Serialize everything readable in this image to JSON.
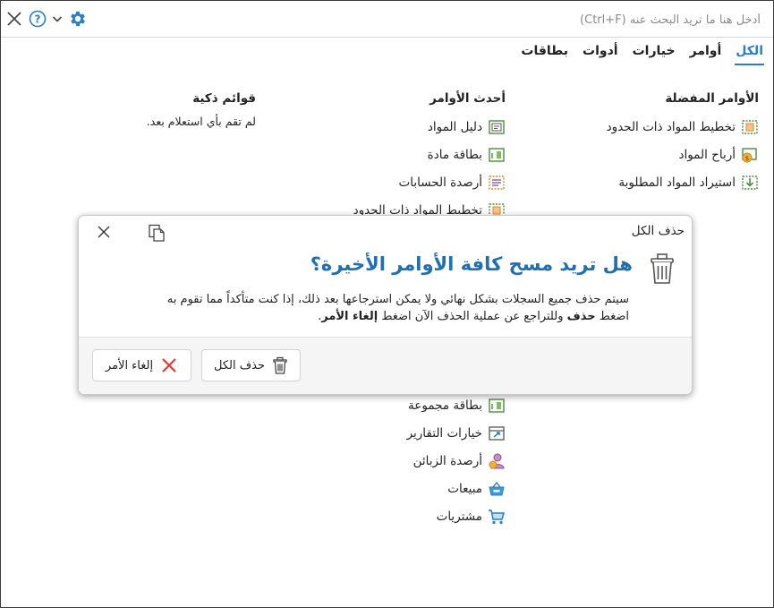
{
  "search": {
    "placeholder": "أدخل هنا ما تريد البحث عنه (Ctrl+F)"
  },
  "tabs": [
    {
      "label": "الكل",
      "active": true
    },
    {
      "label": "أوامر",
      "active": false
    },
    {
      "label": "خيارات",
      "active": false
    },
    {
      "label": "أدوات",
      "active": false
    },
    {
      "label": "بطاقات",
      "active": false
    }
  ],
  "favorites": {
    "title": "الأوامر المفضلة",
    "items": [
      {
        "label": "تخطيط المواد ذات الحدود",
        "icon": "material-planning-icon"
      },
      {
        "label": "أرباح المواد",
        "icon": "material-profit-icon"
      },
      {
        "label": "استيراد المواد المطلوبة",
        "icon": "material-import-icon"
      }
    ]
  },
  "recent": {
    "title": "أحدث الأوامر",
    "items_top": [
      {
        "label": "دليل المواد",
        "icon": "materials-guide-icon"
      },
      {
        "label": "بطاقة مادة",
        "icon": "material-card-icon"
      },
      {
        "label": "أرصدة الحسابات",
        "icon": "account-balances-icon"
      },
      {
        "label": "تخطيط المواد ذات الحدود",
        "icon": "material-planning-icon"
      }
    ],
    "items_bottom": [
      {
        "label": "بطاقة مجموعة",
        "icon": "group-card-icon"
      },
      {
        "label": "خيارات التقارير",
        "icon": "report-options-icon"
      },
      {
        "label": "أرصدة الزبائن",
        "icon": "customer-balances-icon"
      },
      {
        "label": "مبيعات",
        "icon": "sales-basket-icon"
      },
      {
        "label": "مشتريات",
        "icon": "shopping-cart-icon"
      }
    ]
  },
  "smart": {
    "title": "قوائم ذكية",
    "empty_text": "لم تقم بأي استعلام بعد."
  },
  "dialog": {
    "title": "حذف الكل",
    "heading": "هل تريد مسح كافة الأوامر الأخيرة؟",
    "body_line1": "سيتم حذف جميع السجلات بشكل نهائي ولا يمكن استرجاعها بعد ذلك، إذا كنت متأكداً مما تقوم به",
    "body_line2_a": "اضغط ",
    "body_line2_b": "حذف",
    "body_line2_c": " وللتراجع عن عملية الحذف الآن اضغط ",
    "body_line2_d": "إلغاء الأمر",
    "body_line2_e": ".",
    "delete_label": "حذف الكل",
    "cancel_label": "إلغاء الأمر"
  },
  "colors": {
    "accent": "#2a7fc1",
    "heading": "#1f6fb2",
    "danger": "#e53935",
    "icon_green": "#4a8f3a",
    "icon_orange": "#e0892b"
  }
}
